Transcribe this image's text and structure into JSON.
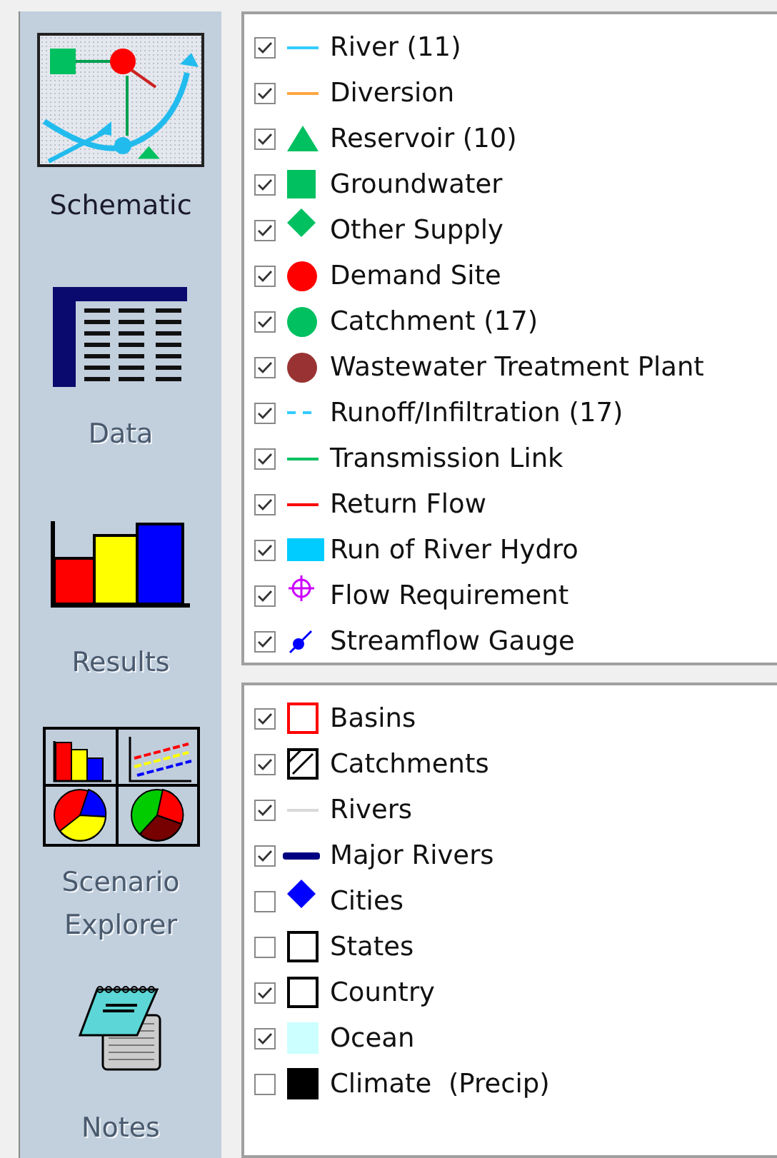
{
  "sidebar": {
    "items": [
      {
        "label": "Schematic",
        "kind": "schematic",
        "selected": true
      },
      {
        "label": "Data",
        "kind": "data",
        "selected": false
      },
      {
        "label": "Results",
        "kind": "results",
        "selected": false
      },
      {
        "label": "Scenario Explorer",
        "kind": "scenario",
        "selected": false
      },
      {
        "label": "Notes",
        "kind": "notes",
        "selected": false
      }
    ]
  },
  "element_layers": [
    {
      "label": "River (11)",
      "kind": "line",
      "color": "#33ccff",
      "checked": true
    },
    {
      "label": "Diversion",
      "kind": "line",
      "color": "#ffa640",
      "checked": true
    },
    {
      "label": "Reservoir (10)",
      "kind": "triangle",
      "color": "#00c060",
      "checked": true
    },
    {
      "label": "Groundwater",
      "kind": "square",
      "color": "#00c060",
      "checked": true
    },
    {
      "label": "Other Supply",
      "kind": "diamond",
      "color": "#00c060",
      "checked": true
    },
    {
      "label": "Demand Site",
      "kind": "circle",
      "color": "#ff0000",
      "checked": true
    },
    {
      "label": "Catchment (17)",
      "kind": "circle",
      "color": "#00c060",
      "checked": true
    },
    {
      "label": "Wastewater Treatment Plant",
      "kind": "circle",
      "color": "#993333",
      "checked": true
    },
    {
      "label": "Runoff/Infiltration (17)",
      "kind": "dashed-line",
      "color": "#33ccff",
      "checked": true
    },
    {
      "label": "Transmission Link",
      "kind": "line",
      "color": "#00c060",
      "checked": true
    },
    {
      "label": "Return Flow",
      "kind": "line",
      "color": "#ff0000",
      "checked": true
    },
    {
      "label": "Run of River Hydro",
      "kind": "wide-rect",
      "color": "#00ccff",
      "checked": true
    },
    {
      "label": "Flow Requirement",
      "kind": "crosshair",
      "color": "#cc00ff",
      "checked": true
    },
    {
      "label": "Streamflow Gauge",
      "kind": "gauge",
      "color": "#0000ff",
      "checked": true
    }
  ],
  "map_layers": [
    {
      "label": "Basins",
      "kind": "outline-box",
      "color": "#ff0000",
      "checked": true
    },
    {
      "label": "Catchments",
      "kind": "hatched-box",
      "color": "#000000",
      "checked": true
    },
    {
      "label": "Rivers",
      "kind": "line",
      "color": "#d8d8d8",
      "checked": true
    },
    {
      "label": "Major Rivers",
      "kind": "thick-line",
      "color": "#000080",
      "checked": true
    },
    {
      "label": "Cities",
      "kind": "diamond",
      "color": "#0000ff",
      "checked": false
    },
    {
      "label": "States",
      "kind": "outline-box",
      "color": "#000000",
      "checked": false
    },
    {
      "label": "Country",
      "kind": "outline-box",
      "color": "#000000",
      "checked": true
    },
    {
      "label": "Ocean",
      "kind": "filled-box",
      "color": "#ccffff",
      "checked": true
    },
    {
      "label": "Climate  (Precip)",
      "kind": "filled-box",
      "color": "#000000",
      "checked": false
    }
  ]
}
